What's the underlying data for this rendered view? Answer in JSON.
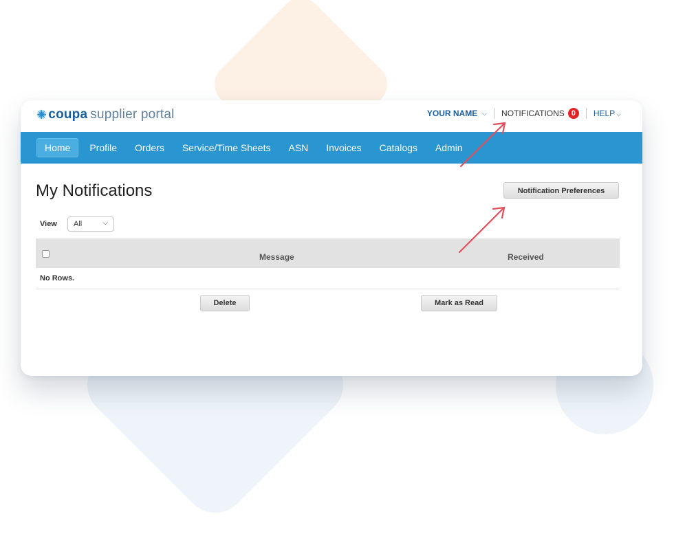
{
  "header": {
    "logo_brand": "coupa",
    "logo_sub": "supplier portal",
    "user_name": "YOUR NAME",
    "notifications_label": "NOTIFICATIONS",
    "notifications_count": "0",
    "help_label": "HELP"
  },
  "nav": {
    "items": [
      {
        "label": "Home"
      },
      {
        "label": "Profile"
      },
      {
        "label": "Orders"
      },
      {
        "label": "Service/Time Sheets"
      },
      {
        "label": "ASN"
      },
      {
        "label": "Invoices"
      },
      {
        "label": "Catalogs"
      },
      {
        "label": "Admin"
      }
    ],
    "active": "Home"
  },
  "page": {
    "title": "My Notifications",
    "preferences_button": "Notification Preferences",
    "view_label": "View",
    "view_selected": "All"
  },
  "table": {
    "columns": [
      "Message",
      "Received"
    ],
    "empty_text": "No Rows."
  },
  "actions": {
    "delete": "Delete",
    "mark_read": "Mark as Read"
  },
  "colors": {
    "nav_bar": "#2a96d1",
    "brand_blue": "#1b5f9e",
    "badge_red": "#e02424",
    "arrow_red": "#e0505a"
  }
}
